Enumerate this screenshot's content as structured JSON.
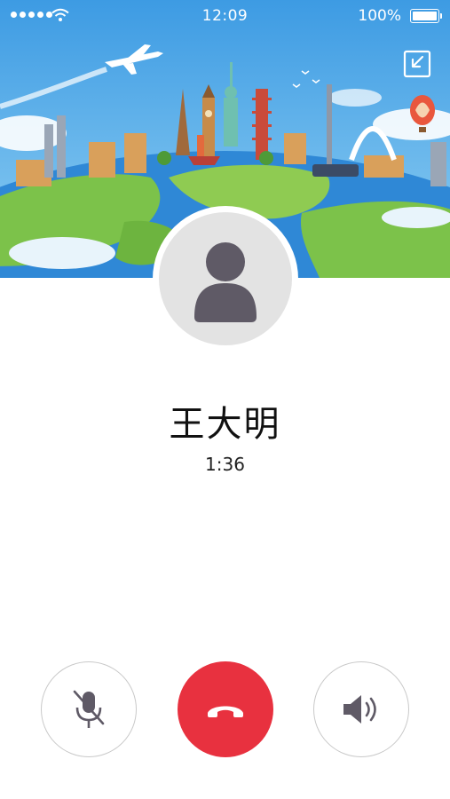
{
  "status_bar": {
    "time": "12:09",
    "battery": "100%",
    "signal_icon": "signal-dots-icon",
    "wifi_icon": "wifi-icon",
    "battery_icon": "battery-full-icon"
  },
  "header": {
    "background": "world-landmarks-illustration",
    "minimize_icon": "minimize-window-icon"
  },
  "caller": {
    "name": "王大明",
    "duration": "1:36",
    "avatar_icon": "person-silhouette-icon"
  },
  "controls": {
    "mute_icon": "microphone-off-icon",
    "hangup_icon": "phone-hangup-icon",
    "speaker_icon": "speaker-icon",
    "hangup_color": "#e8313f"
  },
  "colors": {
    "sky": "#4aa6e6",
    "ocean": "#2f88d6",
    "land": "#7cc24a"
  }
}
